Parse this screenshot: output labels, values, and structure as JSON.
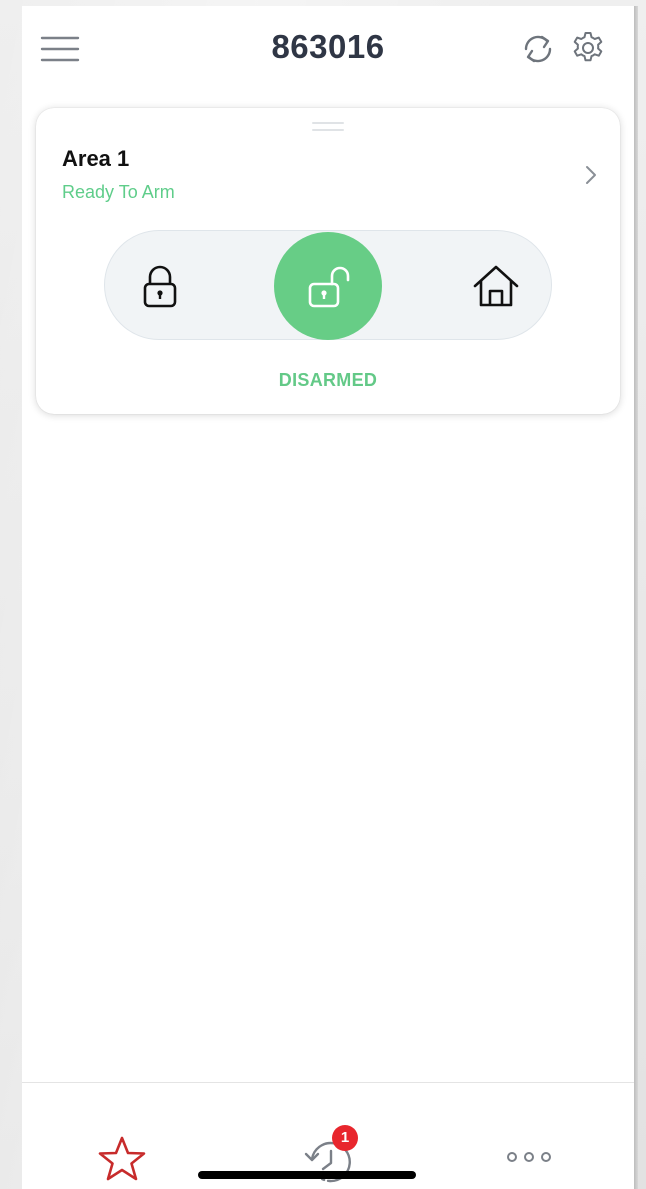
{
  "header": {
    "title": "863016",
    "menu_icon": "hamburger-menu-icon",
    "refresh_icon": "refresh-icon",
    "settings_icon": "gear-icon"
  },
  "area": {
    "name": "Area 1",
    "status": "Ready To Arm",
    "arm_state": "DISARMED",
    "modes": [
      {
        "icon": "locked-padlock-icon",
        "selected": false
      },
      {
        "icon": "unlocked-padlock-icon",
        "selected": true
      },
      {
        "icon": "home-icon",
        "selected": false
      }
    ]
  },
  "tabbar": {
    "items": [
      {
        "icon": "star-icon"
      },
      {
        "icon": "history-clock-icon",
        "badge": "1"
      },
      {
        "icon": "more-dots-icon"
      }
    ]
  },
  "colors": {
    "accent_green": "#67cd86",
    "status_green": "#5fcd8a",
    "badge_red": "#e8262d",
    "star_red": "#c72b2b",
    "title_text": "#2f3645"
  }
}
